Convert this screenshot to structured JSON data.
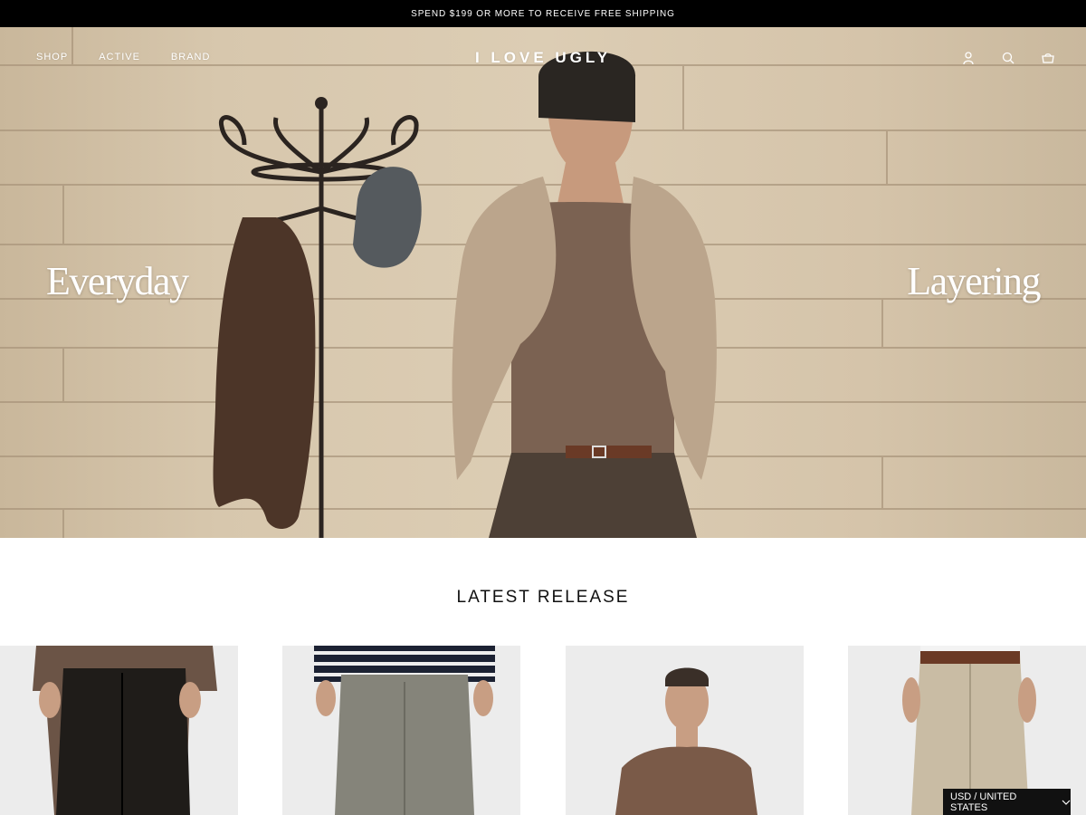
{
  "announcement": "SPEND $199 OR MORE TO RECEIVE FREE SHIPPING",
  "header": {
    "nav": [
      "SHOP",
      "ACTIVE",
      "BRAND"
    ],
    "logo": "I LOVE UGLY",
    "icons": [
      "account-icon",
      "search-icon",
      "cart-icon"
    ]
  },
  "hero": {
    "left_word": "Everyday",
    "right_word": "Layering"
  },
  "latest": {
    "title": "LATEST RELEASE",
    "products": [
      {
        "name": "product-card-pleated-trouser-black"
      },
      {
        "name": "product-card-pleated-trouser-grey"
      },
      {
        "name": "product-card-tee-brown"
      },
      {
        "name": "product-card-chino-stone"
      }
    ]
  },
  "currency": {
    "label": "USD / UNITED STATES"
  },
  "colors": {
    "announcement_bg": "#000000",
    "hero_wall": "#d7c7ad",
    "card_bg": "#ececec"
  }
}
